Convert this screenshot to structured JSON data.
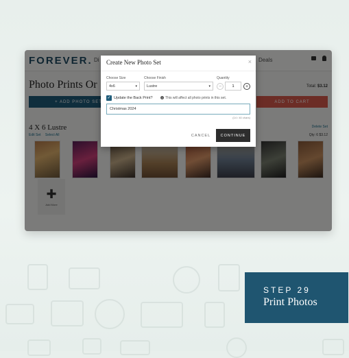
{
  "app": {
    "logo": "FOREVER.",
    "nav_partial_left": "Di",
    "nav_deals": "Deals",
    "page_title": "Photo Prints Or",
    "total_label": "Total:",
    "total_value": "$3.12",
    "add_photo_set_label": "+ ADD PHOTO SET",
    "add_to_cart_label": "ADD TO CART",
    "set_title": "4 X 6 Lustre",
    "set_links": [
      "Edit Set",
      "Select All"
    ],
    "delete_set": "Delete Set",
    "qty_label": "Qty: 6  $3.12",
    "add_more_label": "Add More"
  },
  "modal": {
    "title": "Create New Photo Set",
    "close_icon": "×",
    "size_label": "Choose Size",
    "size_value": "4x6",
    "finish_label": "Choose Finish",
    "finish_value": "Lustre",
    "quantity_label": "Quantity",
    "quantity_value": "1",
    "back_print_label": "Update the Back Print?",
    "back_print_checked": true,
    "info_note": "This will affect all photo prints in this set.",
    "back_print_text": "Christmas 2024",
    "char_count": "(14 / 40 chars)",
    "cancel_label": "CANCEL",
    "continue_label": "CONTINUE"
  },
  "step": {
    "number": "STEP 29",
    "title": "Print Photos"
  },
  "colors": {
    "brand": "#1f5c7a",
    "cart_button": "#d95b4d",
    "badge": "#1f5570"
  }
}
